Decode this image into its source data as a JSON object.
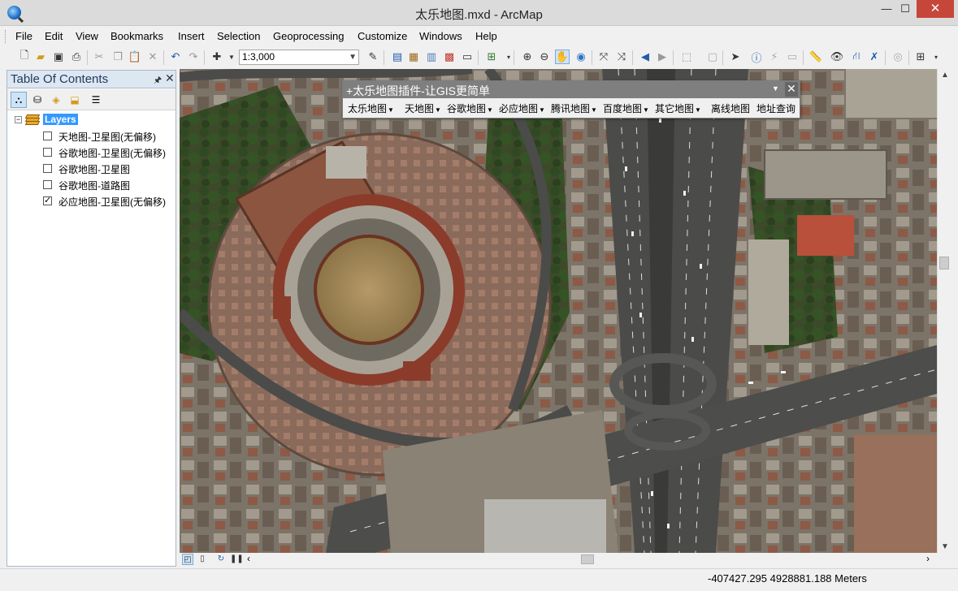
{
  "window": {
    "title": "太乐地图.mxd - ArcMap",
    "min_label": "—",
    "max_label": "☐",
    "close_label": "✕"
  },
  "menubar": {
    "items": [
      "File",
      "Edit",
      "View",
      "Bookmarks",
      "Insert",
      "Selection",
      "Geoprocessing",
      "Customize",
      "Windows",
      "Help"
    ]
  },
  "toolbar": {
    "scale": "1:3,000"
  },
  "toc": {
    "title": "Table Of Contents",
    "pin_icon": "pin-icon",
    "root_label": "Layers",
    "layers": [
      {
        "label": "天地图-卫星图(无偏移)",
        "checked": false
      },
      {
        "label": "谷歌地图-卫星图(无偏移)",
        "checked": false
      },
      {
        "label": "谷歌地图-卫星图",
        "checked": false
      },
      {
        "label": "谷歌地图-道路图",
        "checked": false
      },
      {
        "label": "必应地图-卫星图(无偏移)",
        "checked": true
      }
    ]
  },
  "plugin": {
    "title": "+太乐地图插件-让GIS更简单",
    "menus": [
      {
        "label": "太乐地图",
        "dropdown": true
      },
      {
        "label": "天地图",
        "dropdown": true
      },
      {
        "label": "谷歌地图",
        "dropdown": true
      },
      {
        "label": "必应地图",
        "dropdown": true
      },
      {
        "label": "腾讯地图",
        "dropdown": true
      },
      {
        "label": "百度地图",
        "dropdown": true
      },
      {
        "label": "其它地图",
        "dropdown": true
      },
      {
        "label": "离线地图",
        "dropdown": false
      },
      {
        "label": "地址查询",
        "dropdown": false
      }
    ]
  },
  "status": {
    "coordinates": "-407427.295  4928881.188 Meters"
  },
  "colors": {
    "title_bg": "#dbdbdb",
    "close_button": "#c7463a",
    "toc_header": "#dde7f2",
    "selection": "#3399ff",
    "plugin_header": "#7f7f7f"
  }
}
